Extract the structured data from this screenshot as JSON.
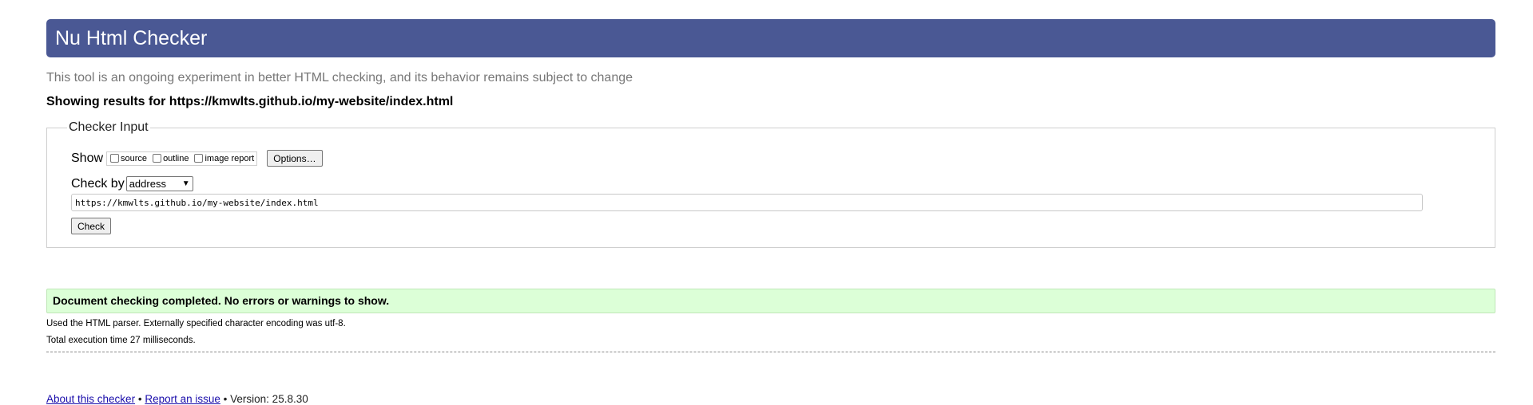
{
  "header": {
    "title": "Nu Html Checker"
  },
  "subtitle": "This tool is an ongoing experiment in better HTML checking, and its behavior remains subject to change",
  "results_for": "Showing results for https://kmwlts.github.io/my-website/index.html",
  "checker_input": {
    "legend": "Checker Input",
    "show_label": "Show",
    "options": [
      {
        "label": "source",
        "checked": false
      },
      {
        "label": "outline",
        "checked": false
      },
      {
        "label": "image report",
        "checked": false
      }
    ],
    "options_button": "Options…",
    "check_by_label": "Check by",
    "check_by_selected": "address",
    "url_value": "https://kmwlts.github.io/my-website/index.html",
    "check_button": "Check"
  },
  "result": {
    "message": "Document checking completed. No errors or warnings to show.",
    "color": "#dcffd7"
  },
  "details": [
    "Used the HTML parser. Externally specified character encoding was utf-8.",
    "Total execution time 27 milliseconds."
  ],
  "footer": {
    "about_link": "About this checker",
    "separator": "•",
    "report_link": "Report an issue",
    "version": "Version: 25.8.30"
  },
  "colors": {
    "header_bg": "#4a5894",
    "link": "#1a0dab"
  }
}
